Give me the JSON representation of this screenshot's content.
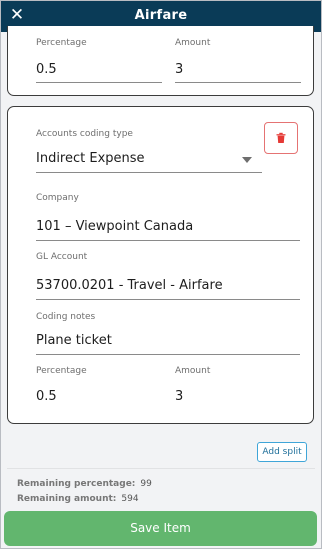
{
  "header": {
    "title": "Airfare",
    "close_icon": "close-icon"
  },
  "split1": {
    "percentage_label": "Percentage",
    "percentage_value": "0.5",
    "amount_label": "Amount",
    "amount_value": "3"
  },
  "split2": {
    "coding_type_label": "Accounts coding type",
    "coding_type_value": "Indirect Expense",
    "company_label": "Company",
    "company_value": "101 – Viewpoint Canada",
    "gl_label": "GL Account",
    "gl_value": "53700.0201 - Travel - Airfare",
    "notes_label": "Coding notes",
    "notes_value": "Plane ticket",
    "percentage_label": "Percentage",
    "percentage_value": "0.5",
    "amount_label": "Amount",
    "amount_value": "3",
    "delete_icon": "trash-icon"
  },
  "actions": {
    "add_split_label": "Add split",
    "save_label": "Save Item"
  },
  "summary": {
    "remaining_percentage_label": "Remaining percentage:",
    "remaining_percentage_value": "99",
    "remaining_amount_label": "Remaining amount:",
    "remaining_amount_value": "594"
  },
  "colors": {
    "header_bg": "#0a3b57",
    "save_button": "#62b66e",
    "delete_border": "#e57373",
    "add_split_border": "#3fa5d8"
  }
}
